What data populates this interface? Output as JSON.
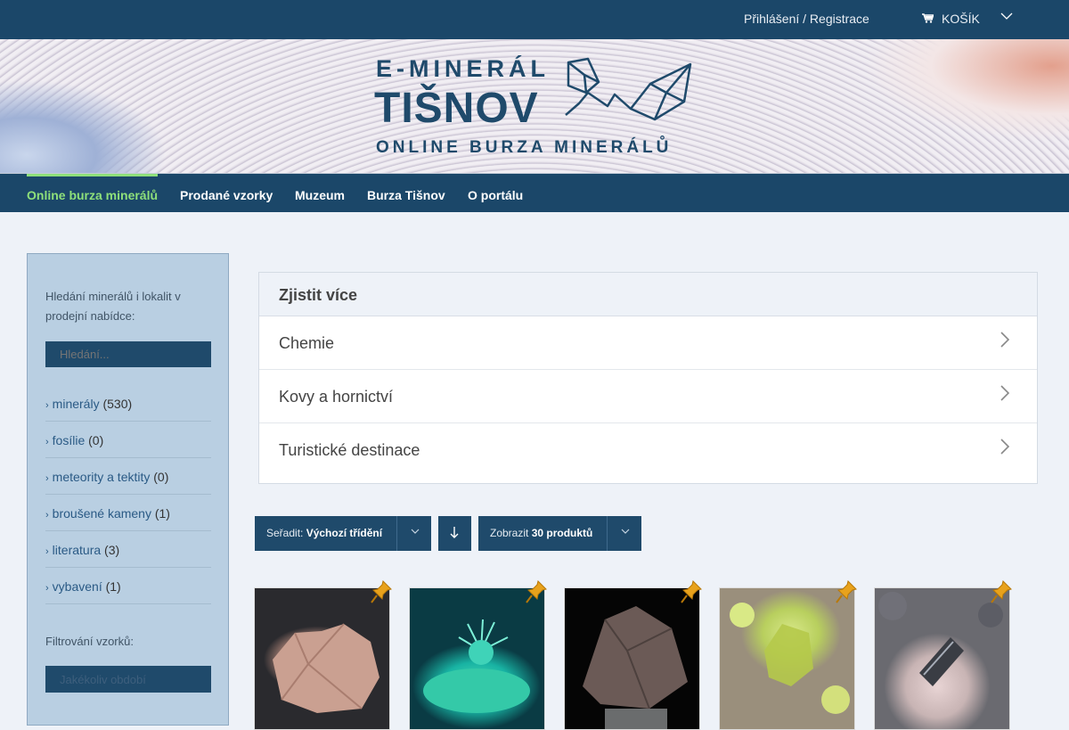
{
  "topbar": {
    "login_label": "Přihlášení / Registrace",
    "cart_label": "KOŠÍK",
    "cart_icon": "shopping-cart-icon",
    "cart_chevron": "﹀"
  },
  "logo": {
    "line1": "E-MINERÁL",
    "line2": "TIŠNOV",
    "line3": "ONLINE BURZA MINERÁLŮ"
  },
  "nav": {
    "items": [
      "Online burza minerálů",
      "Prodané vzorky",
      "Muzeum",
      "Burza Tišnov",
      "O portálu"
    ],
    "active_color": "#8ee07a"
  },
  "sidebar": {
    "intro": "Hledání minerálů i lokalit v prodejní nabídce:",
    "search_placeholder": "Hledání...",
    "categories": [
      {
        "label": "minerály",
        "count": "(530)"
      },
      {
        "label": "fosílie",
        "count": "(0)"
      },
      {
        "label": "meteority a tektity",
        "count": "(0)"
      },
      {
        "label": "broušené kameny",
        "count": "(1)"
      },
      {
        "label": "literatura",
        "count": "(3)"
      },
      {
        "label": "vybavení",
        "count": "(1)"
      }
    ],
    "filter_label": "Filtrování vzorků:",
    "filter_placeholder": "Jakékoliv období"
  },
  "accordion": {
    "title": "Zjistit více",
    "rows": [
      "Chemie",
      "Kovy a hornictví",
      "Turistické destinace"
    ]
  },
  "sorting": {
    "sort_label": "Seřadit:",
    "sort_value": "Výchozí třídění",
    "show_label": "Zobrazit",
    "show_value": "30 produktů",
    "direction_icon": "arrow-down-icon"
  },
  "colors": {
    "primary": "#1b4769",
    "sidebar_bg": "#b9cfe2",
    "pin": "#e8a21c"
  }
}
